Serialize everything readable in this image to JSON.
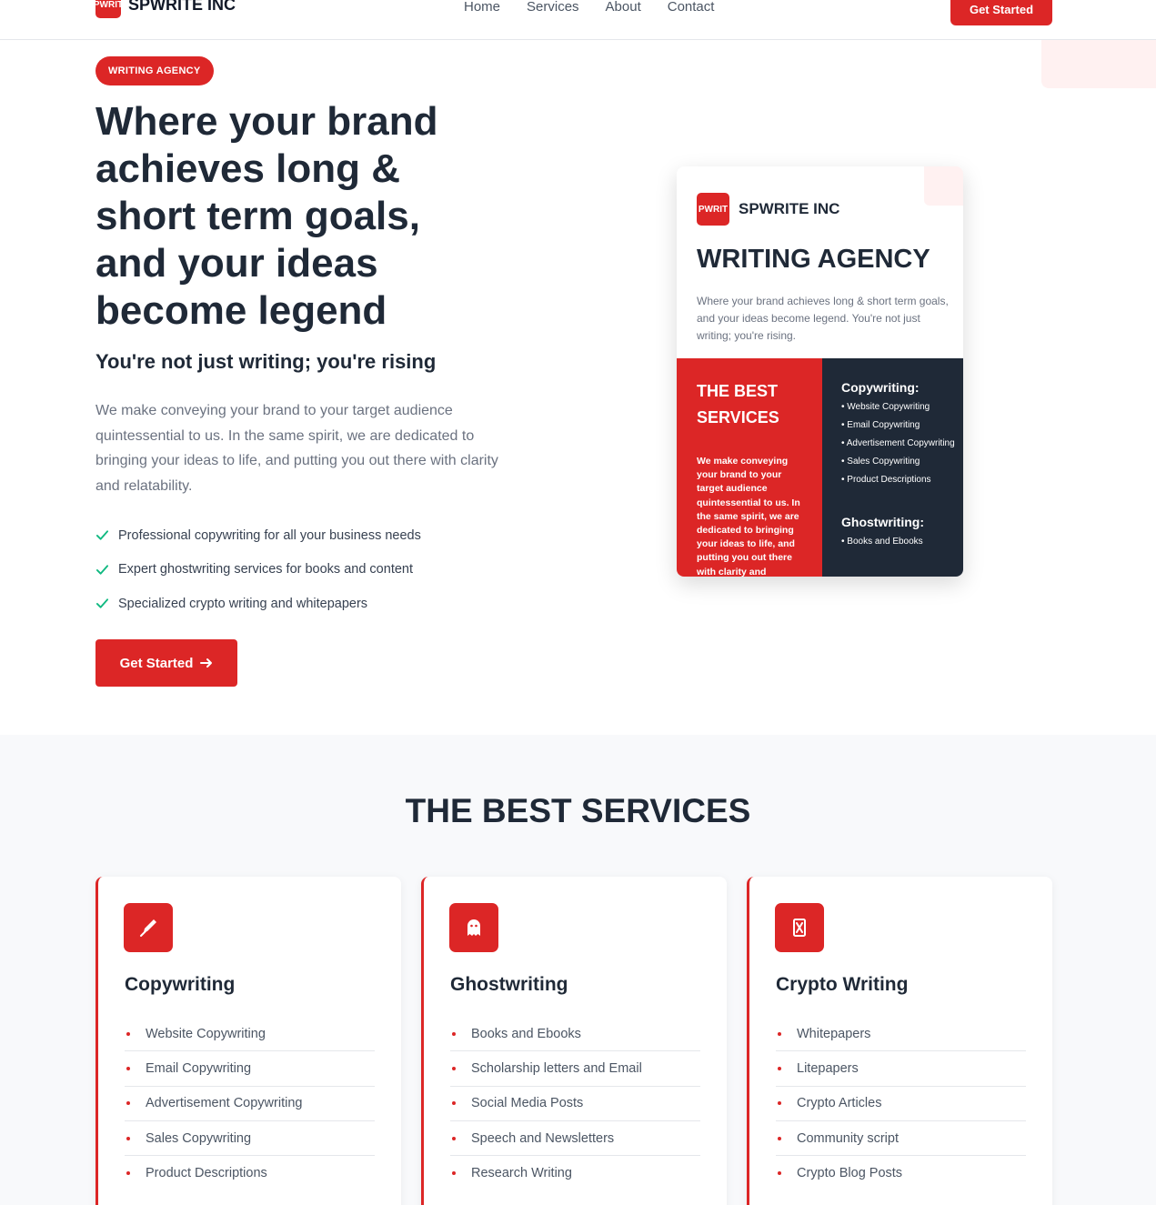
{
  "nav": {
    "logo_mark": "PWRIT",
    "brand": "SPWRITE INC",
    "links": [
      "Home",
      "Services",
      "About",
      "Contact"
    ],
    "cta": "Get Started"
  },
  "hero": {
    "badge": "WRITING AGENCY",
    "title": "Where your brand achieves long & short term goals, and your ideas become legend",
    "subtitle": "You're not just writing; you're rising",
    "description": "We make conveying your brand to your target audience quintessential to us. In the same spirit, we are dedicated to bringing your ideas to life, and putting you out there with clarity and relatability.",
    "checks": [
      "Professional copywriting for all your business needs",
      "Expert ghostwriting services for books and content",
      "Specialized crypto writing and whitepapers"
    ],
    "cta": "Get Started",
    "cta_icon": "arrow-right-icon",
    "check_color": "#10b981"
  },
  "preview_card": {
    "logo_mark": "PWRIT",
    "brand": "SPWRITE INC",
    "heading": "WRITING AGENCY",
    "description": "Where your brand achieves long & short term goals, and your ideas become legend. You're not just writing; you're rising.",
    "red_title": "THE BEST SERVICES",
    "red_description": "We make conveying your brand to your target audience quintessential to us. In the same spirit, we are dedicated to bringing your ideas to life, and putting you out there with clarity and",
    "copywriting_title": "Copywriting:",
    "copywriting_items": [
      "Website Copywriting",
      "Email Copywriting",
      "Advertisement Copywriting",
      "Sales Copywriting",
      "Product Descriptions"
    ],
    "ghostwriting_title": "Ghostwriting:",
    "ghostwriting_items": [
      "Books and Ebooks"
    ]
  },
  "services": {
    "title": "THE BEST SERVICES",
    "cards": [
      {
        "icon": "pen-nib-icon",
        "title": "Copywriting",
        "items": [
          "Website Copywriting",
          "Email Copywriting",
          "Advertisement Copywriting",
          "Sales Copywriting",
          "Product Descriptions"
        ]
      },
      {
        "icon": "ghost-icon",
        "title": "Ghostwriting",
        "items": [
          "Books and Ebooks",
          "Scholarship letters and Email",
          "Social Media Posts",
          "Speech and Newsletters",
          "Research Writing"
        ]
      },
      {
        "icon": "bitcoin-icon",
        "title": "Crypto Writing",
        "items": [
          "Whitepapers",
          "Litepapers",
          "Crypto Articles",
          "Community script",
          "Crypto Blog Posts"
        ]
      }
    ]
  },
  "colors": {
    "accent": "#dc2626",
    "dark": "#1f2937",
    "tint": "#fff1f1"
  }
}
